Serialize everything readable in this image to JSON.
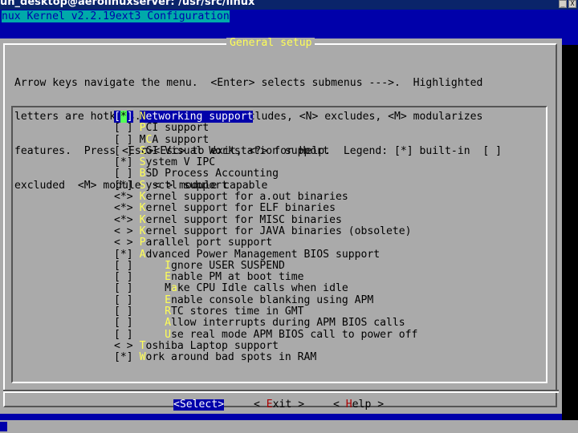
{
  "window": {
    "title": "un_desktop@aerolinuxserver: /usr/src/linux",
    "min_label": "_",
    "close_label": "X"
  },
  "terminal": {
    "heading": "nux Kernel v2.2.19ext3 Configuration",
    "heading_rule": "                                                                                             "
  },
  "dialog": {
    "title": "General setup",
    "help_lines": [
      "Arrow keys navigate the menu.  <Enter> selects submenus --->.  Highlighted",
      "letters are hotkeys.  Pressing <Y> includes, <N> excludes, <M> modularizes",
      "features.  Press <Esc><Esc> to exit, <?> for Help.  Legend: [*] built-in  [ ]",
      "excluded  <M> module  < > module capable"
    ],
    "items": [
      {
        "box_open": "[",
        "mark": "*",
        "box_close": "]",
        "indent": " ",
        "hotkey": "N",
        "rest": "etworking support",
        "selected": true
      },
      {
        "box_open": "[",
        "mark": " ",
        "box_close": "]",
        "indent": " ",
        "hotkey": "P",
        "rest": "CI support",
        "selected": false
      },
      {
        "box_open": "[",
        "mark": " ",
        "box_close": "]",
        "indent": " ",
        "hotkey": "",
        "pre": "M",
        "hk2": "C",
        "rest": "A support",
        "selected": false
      },
      {
        "box_open": "[",
        "mark": " ",
        "box_close": "]",
        "indent": " ",
        "hotkey": "S",
        "rest": "GI Visual Workstation support",
        "selected": false
      },
      {
        "box_open": "[",
        "mark": "*",
        "box_close": "]",
        "indent": " ",
        "hotkey": "S",
        "rest": "ystem V IPC",
        "selected": false
      },
      {
        "box_open": "[",
        "mark": " ",
        "box_close": "]",
        "indent": " ",
        "hotkey": "B",
        "rest": "SD Process Accounting",
        "selected": false
      },
      {
        "box_open": "[",
        "mark": "*",
        "box_close": "]",
        "indent": " ",
        "hotkey": "S",
        "rest": "ysctl support",
        "selected": false
      },
      {
        "box_open": "<",
        "mark": "*",
        "box_close": ">",
        "indent": " ",
        "hotkey": "K",
        "rest": "ernel support for a.out binaries",
        "selected": false
      },
      {
        "box_open": "<",
        "mark": "*",
        "box_close": ">",
        "indent": " ",
        "hotkey": "K",
        "rest": "ernel support for ELF binaries",
        "selected": false
      },
      {
        "box_open": "<",
        "mark": "*",
        "box_close": ">",
        "indent": " ",
        "hotkey": "K",
        "rest": "ernel support for MISC binaries",
        "selected": false
      },
      {
        "box_open": "<",
        "mark": " ",
        "box_close": ">",
        "indent": " ",
        "hotkey": "K",
        "rest": "ernel support for JAVA binaries (obsolete)",
        "selected": false
      },
      {
        "box_open": "<",
        "mark": " ",
        "box_close": ">",
        "indent": " ",
        "hotkey": "P",
        "rest": "arallel port support",
        "selected": false
      },
      {
        "box_open": "[",
        "mark": "*",
        "box_close": "]",
        "indent": " ",
        "hotkey": "A",
        "rest": "dvanced Power Management BIOS support",
        "selected": false
      },
      {
        "box_open": "[",
        "mark": " ",
        "box_close": "]",
        "indent": "     ",
        "hotkey": "I",
        "rest": "gnore USER SUSPEND",
        "selected": false
      },
      {
        "box_open": "[",
        "mark": " ",
        "box_close": "]",
        "indent": "     ",
        "hotkey": "E",
        "rest": "nable PM at boot time",
        "selected": false
      },
      {
        "box_open": "[",
        "mark": " ",
        "box_close": "]",
        "indent": "     ",
        "hotkey": "",
        "pre": "M",
        "hk2": "a",
        "rest": "ke CPU Idle calls when idle",
        "selected": false
      },
      {
        "box_open": "[",
        "mark": " ",
        "box_close": "]",
        "indent": "     ",
        "hotkey": "E",
        "rest": "nable console blanking using APM",
        "selected": false
      },
      {
        "box_open": "[",
        "mark": " ",
        "box_close": "]",
        "indent": "     ",
        "hotkey": "R",
        "rest": "TC stores time in GMT",
        "selected": false
      },
      {
        "box_open": "[",
        "mark": " ",
        "box_close": "]",
        "indent": "     ",
        "hotkey": "A",
        "rest": "llow interrupts during APM BIOS calls",
        "selected": false
      },
      {
        "box_open": "[",
        "mark": " ",
        "box_close": "]",
        "indent": "     ",
        "hotkey": "U",
        "rest": "se real mode APM BIOS call to power off",
        "selected": false
      },
      {
        "box_open": "<",
        "mark": " ",
        "box_close": ">",
        "indent": " ",
        "hotkey": "T",
        "rest": "oshiba Laptop support",
        "selected": false
      },
      {
        "box_open": "[",
        "mark": "*",
        "box_close": "]",
        "indent": " ",
        "hotkey": "W",
        "rest": "ork around bad spots in RAM",
        "selected": false
      }
    ],
    "buttons": {
      "select": {
        "open": "<",
        "hotkey": "S",
        "rest": "elect",
        "close": ">"
      },
      "exit": {
        "open": "< ",
        "hotkey": "E",
        "rest": "xit",
        "close": " >"
      },
      "help": {
        "open": "< ",
        "hotkey": "H",
        "rest": "elp",
        "close": " >"
      }
    }
  },
  "colors": {
    "background": "#0000aa",
    "dialog": "#aaaaaa",
    "title": "#ffff55",
    "hotkey": "#ffff55",
    "selected_bg": "#0000aa",
    "mark_highlight": "#55ff55",
    "button_hotkey": "#aa0000"
  }
}
